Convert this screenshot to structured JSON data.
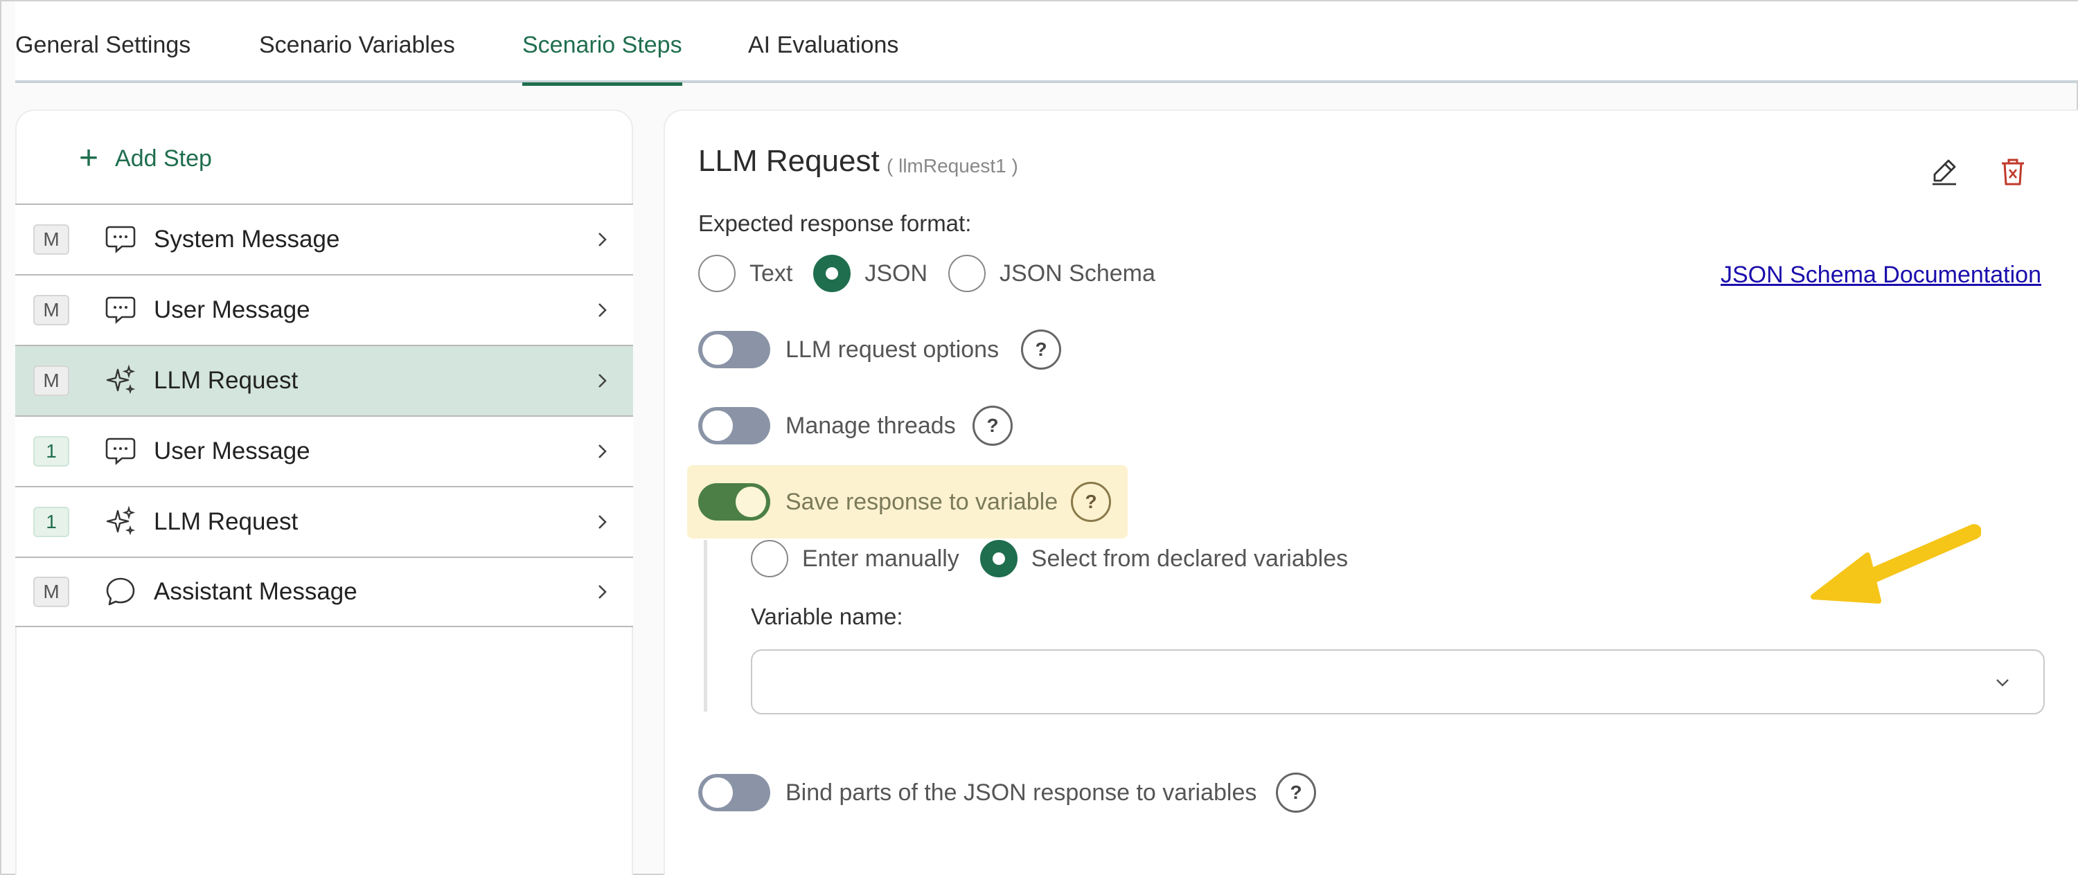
{
  "tabs": [
    {
      "label": "General Settings"
    },
    {
      "label": "Scenario Variables"
    },
    {
      "label": "Scenario Steps"
    },
    {
      "label": "AI Evaluations"
    }
  ],
  "active_tab": "Scenario Steps",
  "add_step_label": "Add Step",
  "steps": [
    {
      "badge": "M",
      "icon": "chat-bubble-icon",
      "label": "System Message"
    },
    {
      "badge": "M",
      "icon": "chat-bubble-icon",
      "label": "User Message"
    },
    {
      "badge": "M",
      "icon": "sparkles-icon",
      "label": "LLM Request",
      "selected": true
    },
    {
      "badge": "1",
      "icon": "chat-bubble-icon",
      "label": "User Message"
    },
    {
      "badge": "1",
      "icon": "sparkles-icon",
      "label": "LLM Request"
    },
    {
      "badge": "M",
      "icon": "speech-bubble-icon",
      "label": "Assistant Message"
    }
  ],
  "detail": {
    "title": "LLM Request",
    "subtitle": "( llmRequest1 )",
    "expected_format_label": "Expected response format:",
    "formats": [
      {
        "label": "Text",
        "checked": false
      },
      {
        "label": "JSON",
        "checked": true
      },
      {
        "label": "JSON Schema",
        "checked": false
      }
    ],
    "schema_link": "JSON Schema Documentation",
    "toggles": {
      "llm_options": {
        "label": "LLM request options",
        "on": false
      },
      "manage_threads": {
        "label": "Manage threads",
        "on": false
      },
      "save_response": {
        "label": "Save response to variable",
        "on": true
      },
      "bind_parts": {
        "label": "Bind parts of the JSON response to variables",
        "on": false
      }
    },
    "help_glyph": "?",
    "variable_source": [
      {
        "label": "Enter manually",
        "checked": false
      },
      {
        "label": "Select from declared variables",
        "checked": true
      }
    ],
    "variable_name_label": "Variable name:",
    "variable_name_value": ""
  },
  "colors": {
    "accent": "#1f6e4e",
    "selected_row": "#d4e5dd",
    "highlight": "#fdf2cf",
    "annotation_arrow": "#f5c518",
    "delete": "#c0392b"
  }
}
